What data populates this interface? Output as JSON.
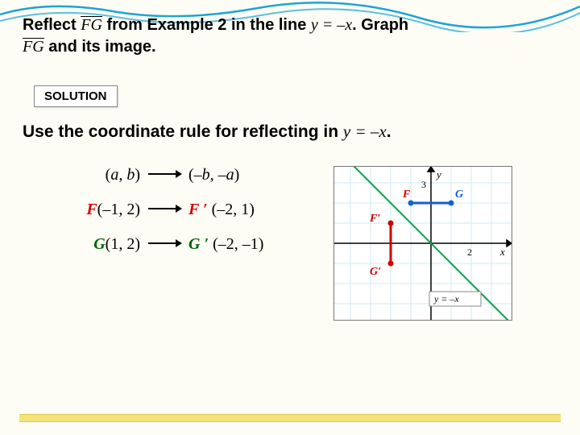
{
  "problem": {
    "prefix": "Reflect ",
    "seg1": "FG",
    "mid1": " from Example 2 in the line ",
    "equation": "y = –x",
    "mid2": ".  Graph ",
    "seg2": "FG",
    "suffix": " and its image."
  },
  "solution_label": "SOLUTION",
  "rule": {
    "text": "Use the coordinate rule for reflecting in ",
    "equation": "y = –x",
    "period": "."
  },
  "mappings": [
    {
      "lhs_html": "(a, b)",
      "rhs_html": "(–b, –a)",
      "color": ""
    },
    {
      "lhs_pt": "F",
      "lhs_coords": "(–1, 2)",
      "rhs_pt": "F ′",
      "rhs_coords": "(–2, 1)",
      "color": "F"
    },
    {
      "lhs_pt": "G",
      "lhs_coords": "(1, 2)",
      "rhs_pt": "G ′",
      "rhs_coords": "(–2, –1)",
      "color": "G"
    }
  ],
  "graph": {
    "points": {
      "F": {
        "x": -1,
        "y": 2,
        "label": "F"
      },
      "G": {
        "x": 1,
        "y": 2,
        "label": "G"
      },
      "Fp": {
        "x": -2,
        "y": 1,
        "label": "F′"
      },
      "Gp": {
        "x": -2,
        "y": -1,
        "label": "G′"
      }
    },
    "axis_labels": {
      "x": "x",
      "y": "y",
      "xtick": "2",
      "ytick": "3"
    },
    "line_label": "y = –x"
  }
}
